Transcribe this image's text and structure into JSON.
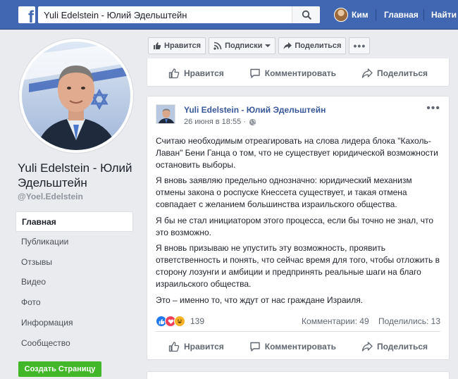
{
  "topbar": {
    "logo_letter": "f",
    "search_value": "Yuli Edelstein - Юлий Эдельштейн",
    "user_name": "Ким",
    "home_label": "Главная",
    "find_label": "Найти д"
  },
  "page": {
    "name": "Yuli Edelstein - Юлий Эдельштейн",
    "handle": "@Yoel.Edelstein"
  },
  "left_nav": {
    "items": [
      {
        "label": "Главная",
        "active": true
      },
      {
        "label": "Публикации"
      },
      {
        "label": "Отзывы"
      },
      {
        "label": "Видео"
      },
      {
        "label": "Фото"
      },
      {
        "label": "Информация"
      },
      {
        "label": "Сообщество"
      }
    ],
    "create_page_label": "Создать Страницу"
  },
  "page_actions": {
    "like_label": "Нравится",
    "follow_label": "Подписки",
    "share_label": "Поделиться",
    "more_label": "•••"
  },
  "post_actions": {
    "like_label": "Нравится",
    "comment_label": "Комментировать",
    "share_label": "Поделиться"
  },
  "post": {
    "author": "Yuli Edelstein - Юлий Эдельштейн",
    "time": "26 июня в 18:55 ·",
    "menu": "•••",
    "paragraphs": [
      "Считаю необходимым отреагировать на слова лидера блока \"Кахоль-Лаван\" Бени Ганца о том, что не существует юридической возможности остановить выборы.",
      "Я вновь заявляю предельно однозначно: юридический механизм отмены закона о роспуске Кнессета существует, и такая отмена совпадает с желанием большинства израильского общества.",
      "Я бы не стал инициатором этого процесса, если бы точно не знал, что это возможно.",
      "Я вновь призываю не упустить эту возможность, проявить ответственность и понять, что сейчас время для того, чтобы отложить в сторону лозунги и амбиции и предпринять реальные шаги на благо израильского общества.",
      "Это – именно то, что ждут от нас граждане Израиля."
    ],
    "reaction_count": "139",
    "comments": "Комментарии: 49",
    "shares": "Поделились: 13"
  },
  "colors": {
    "brand_blue": "#4267b2",
    "link_blue": "#385898",
    "green": "#42b72a",
    "like_blue": "#2078f4",
    "love_red": "#f33e58",
    "haha_yellow": "#f7b125"
  }
}
